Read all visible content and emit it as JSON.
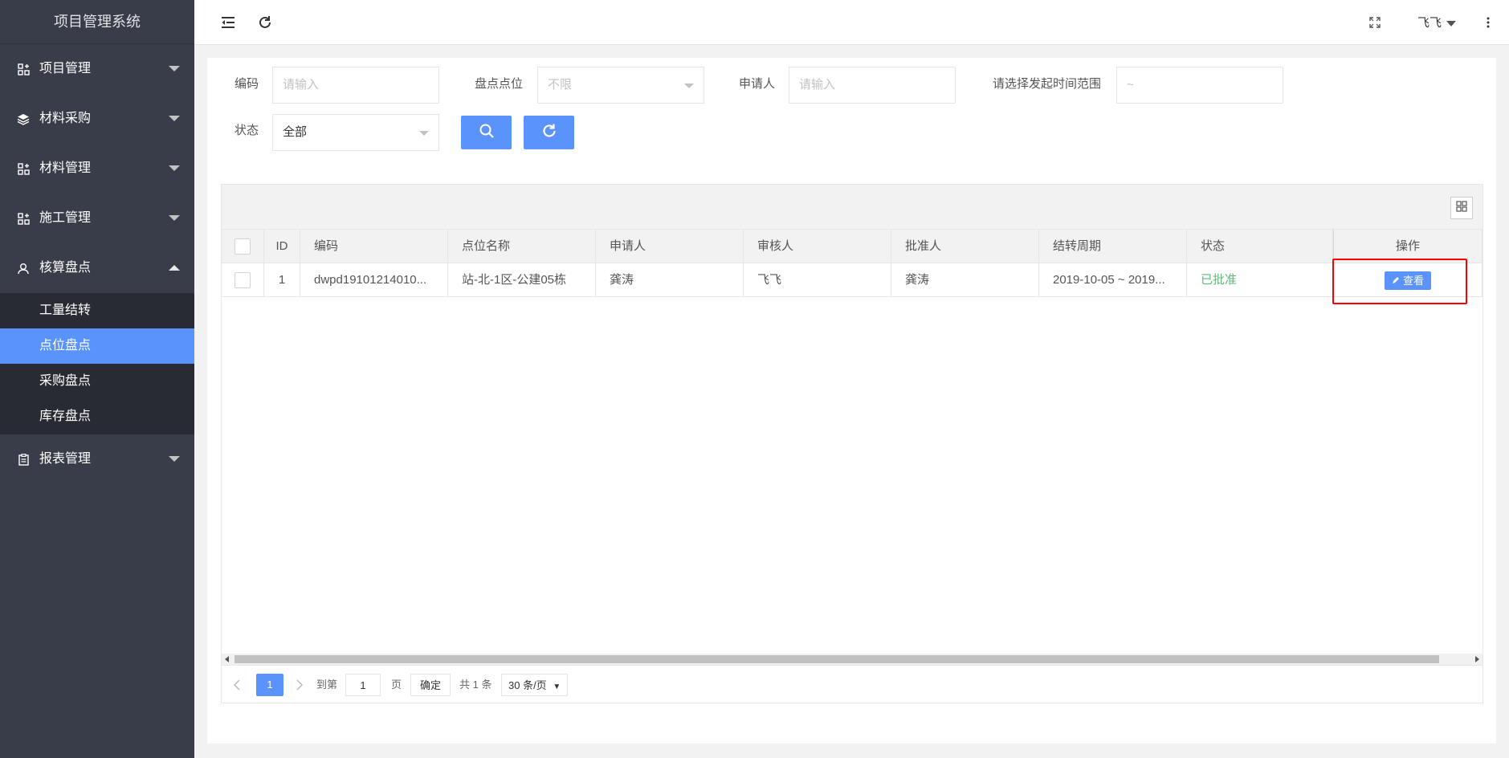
{
  "app": {
    "title": "项目管理系统"
  },
  "sidebar": {
    "items": [
      {
        "label": "项目管理",
        "icon": "grid-plus-icon",
        "expanded": false
      },
      {
        "label": "材料采购",
        "icon": "layers-icon",
        "expanded": false
      },
      {
        "label": "材料管理",
        "icon": "grid-plus-icon",
        "expanded": false
      },
      {
        "label": "施工管理",
        "icon": "grid-plus-icon",
        "expanded": false
      },
      {
        "label": "核算盘点",
        "icon": "user-icon",
        "expanded": true
      },
      {
        "label": "报表管理",
        "icon": "clipboard-icon",
        "expanded": false
      }
    ],
    "subitems": [
      {
        "label": "工量结转",
        "active": false
      },
      {
        "label": "点位盘点",
        "active": true
      },
      {
        "label": "采购盘点",
        "active": false
      },
      {
        "label": "库存盘点",
        "active": false
      }
    ]
  },
  "header": {
    "user_name": "飞飞",
    "icons": [
      "menu-fold-icon",
      "refresh-icon",
      "fullscreen-icon",
      "more-vertical-icon"
    ]
  },
  "filters": {
    "code_label": "编码",
    "code_placeholder": "请输入",
    "location_label": "盘点点位",
    "location_value": "不限",
    "applicant_label": "申请人",
    "applicant_placeholder": "请输入",
    "date_label": "请选择发起时间范围",
    "date_placeholder": "~",
    "status_label": "状态",
    "status_value": "全部"
  },
  "table": {
    "columns": [
      "ID",
      "编码",
      "点位名称",
      "申请人",
      "审核人",
      "批准人",
      "结转周期",
      "状态",
      "操作"
    ],
    "rows": [
      {
        "id": "1",
        "code": "dwpd19101214010...",
        "location": "站-北-1区-公建05栋",
        "applicant": "龚涛",
        "reviewer": "飞飞",
        "approver": "龚涛",
        "period": "2019-10-05 ~ 2019...",
        "status": "已批准",
        "action": "查看"
      }
    ]
  },
  "pagination": {
    "current": "1",
    "goto_label": "到第",
    "goto_value": "1",
    "page_unit": "页",
    "confirm": "确定",
    "total": "共 1 条",
    "page_size": "30 条/页"
  },
  "colors": {
    "accent": "#5b93fc",
    "sidebar_bg": "#393d49",
    "submenu_bg": "#282b33",
    "status_ok": "#5fb878",
    "highlight": "#ff0000"
  }
}
